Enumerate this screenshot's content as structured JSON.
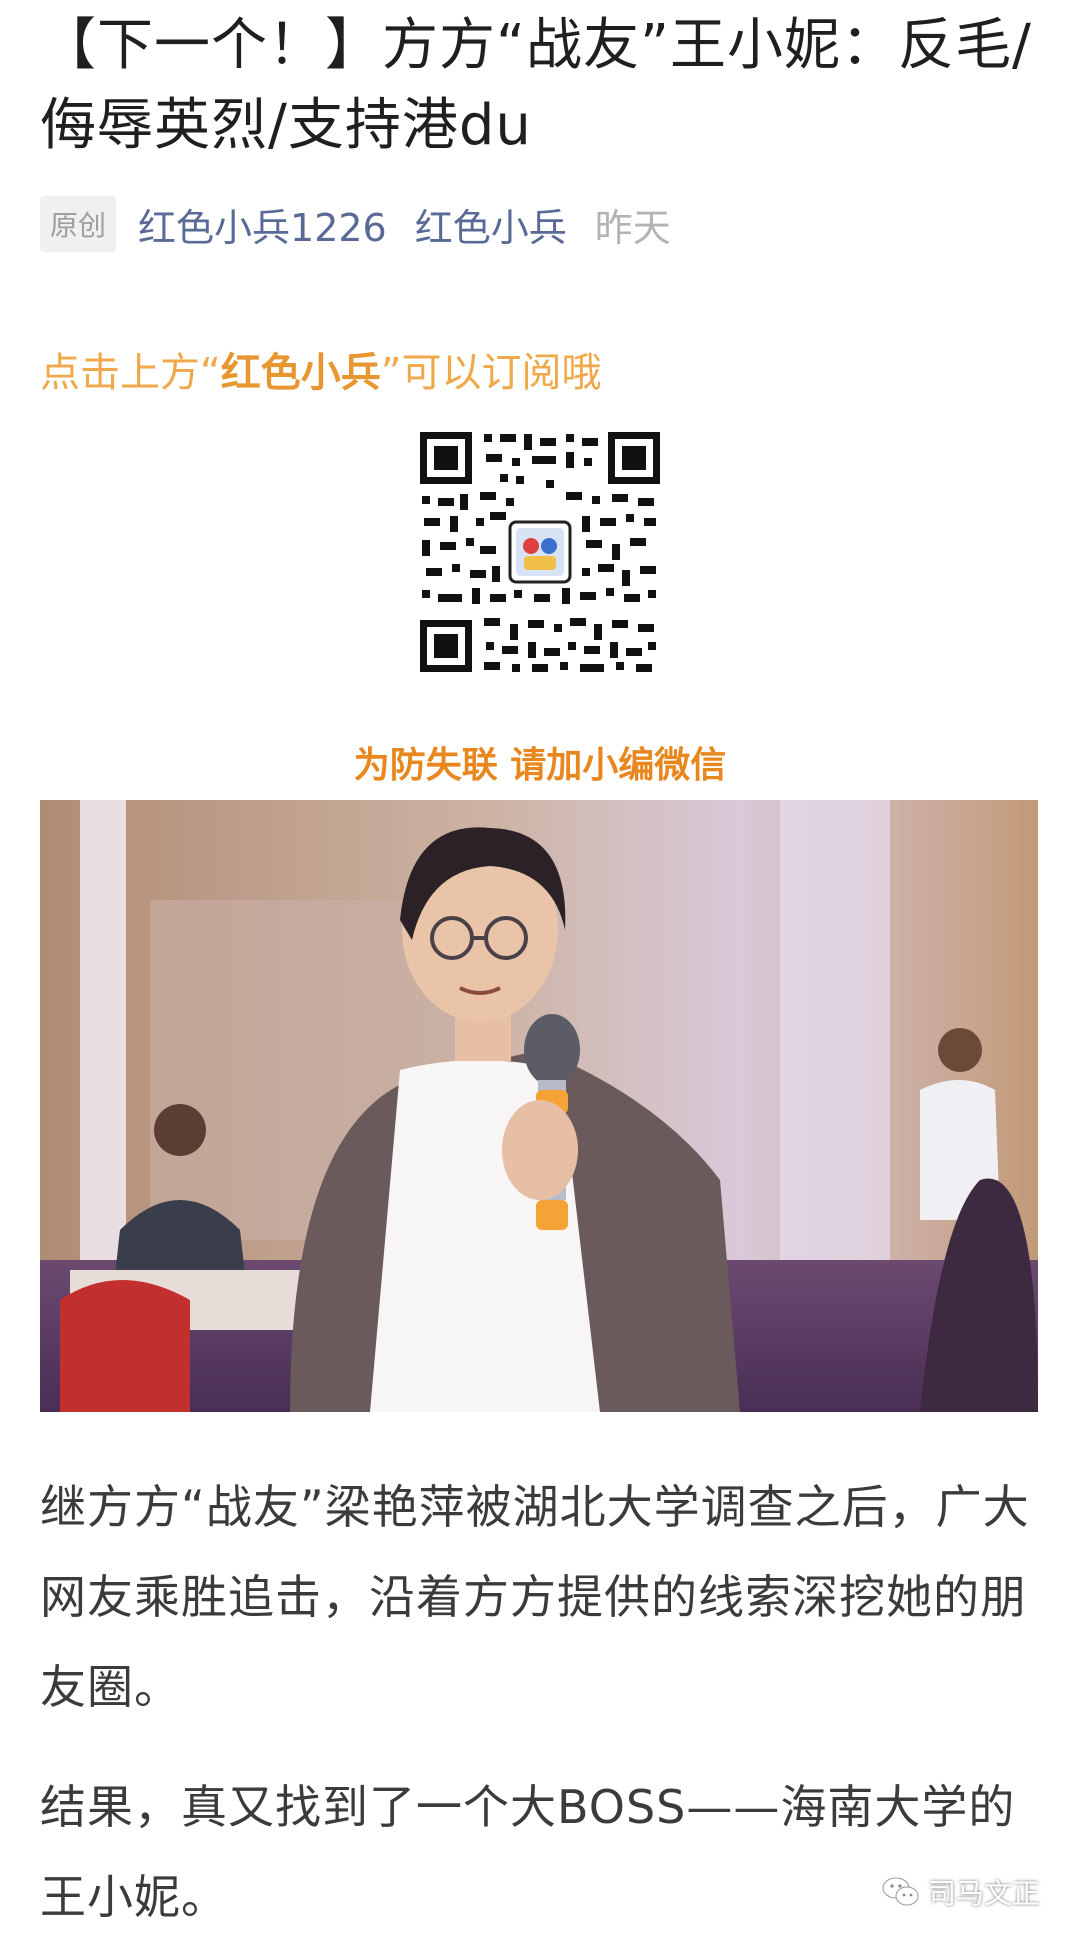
{
  "article": {
    "title": "【下一个！】方方“战友”王小妮：反毛/侮辱英烈/支持港du",
    "original_badge": "原创",
    "account_name": "红色小兵1226",
    "author": "红色小兵",
    "date": "昨天"
  },
  "promo": {
    "subscribe_prefix": "点击上方“",
    "subscribe_emph": "红色小兵",
    "subscribe_suffix": "”可以订阅哦",
    "qr_icon": "qr-code-icon",
    "follow_note": "为防失联 请加小编微信"
  },
  "body": {
    "paragraph_1": "继方方“战友”梁艳萍被湖北大学调查之后，广大网友乘胜追击，沿着方方提供的线索深挖她的朋友圈。",
    "paragraph_2": "结果，真又找到了一个大BOSS——海南大学的王小妮。"
  },
  "watermark": {
    "icon": "wechat-icon",
    "text": "司马文正"
  },
  "colors": {
    "promo_orange": "#efa84a",
    "link_blue": "#5a6a96",
    "meta_gray": "#b3b3b3"
  }
}
